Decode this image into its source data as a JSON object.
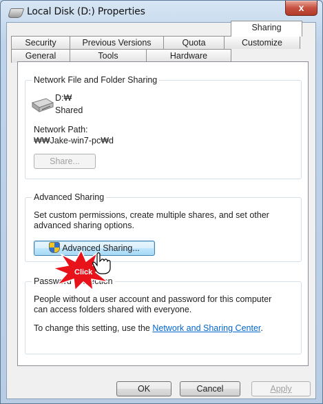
{
  "window": {
    "title": "Local Disk (D:) Properties",
    "close_symbol": "x"
  },
  "tabs": {
    "row1": [
      "Security",
      "Previous Versions",
      "Quota",
      "Customize"
    ],
    "row2": [
      "General",
      "Tools",
      "Hardware",
      "Sharing"
    ],
    "selected": "Sharing"
  },
  "network_sharing": {
    "group_label": "Network File and Folder Sharing",
    "drive_name": "D:₩",
    "drive_status": "Shared",
    "path_label": "Network Path:",
    "path_value": "₩₩Jake-win7-pc₩d",
    "share_button": "Share..."
  },
  "advanced_sharing": {
    "group_label": "Advanced Sharing",
    "description_line1": "Set custom permissions, create multiple shares, and set other",
    "description_line2": "advanced sharing options.",
    "button_label": "Advanced Sharing..."
  },
  "password_protection": {
    "group_label": "Password Protection",
    "description_line1": "People without a user account and password for this computer",
    "description_line2": "can access folders shared with everyone.",
    "change_prefix": "To change this setting, use the ",
    "link_text": "Network and Sharing Center",
    "change_suffix": "."
  },
  "annotation": {
    "label": "Click",
    "color": "#e8121b"
  },
  "footer": {
    "ok": "OK",
    "cancel": "Cancel",
    "apply": "Apply"
  },
  "colors": {
    "link": "#0066cc",
    "close_button": "#c75140",
    "panel": "#ffffff"
  }
}
